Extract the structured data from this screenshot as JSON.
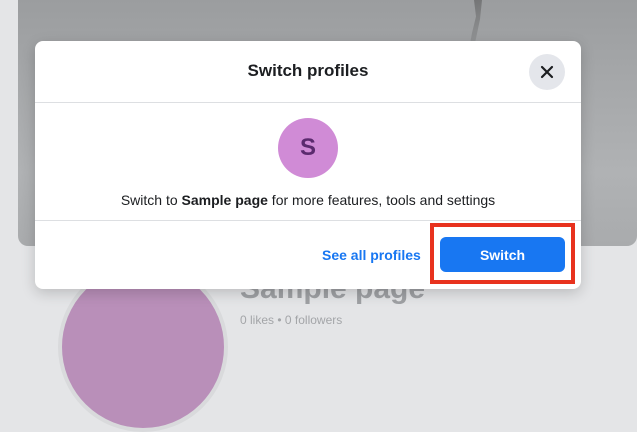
{
  "background_page": {
    "title": "Sample page",
    "stats": "0 likes • 0 followers"
  },
  "dialog": {
    "title": "Switch profiles",
    "close_icon": "close-icon",
    "avatar_letter": "S",
    "message_prefix": "Switch to ",
    "message_page_name": "Sample page",
    "message_suffix": " for more features, tools and settings",
    "see_all_label": "See all profiles",
    "switch_label": "Switch"
  },
  "colors": {
    "primary_button": "#1877f2",
    "link": "#1877f2",
    "avatar": "#d08bd6",
    "highlight_annotation": "#e8321e"
  }
}
